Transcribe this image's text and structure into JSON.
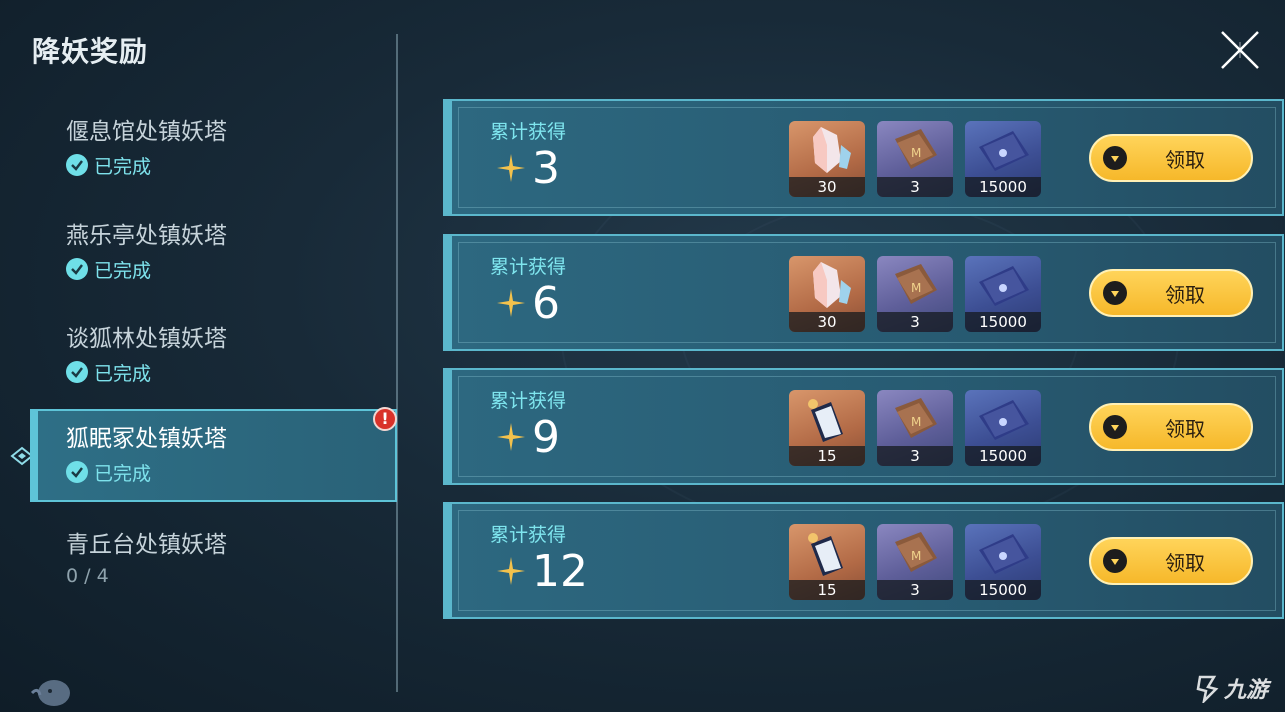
{
  "page": {
    "title": "降妖奖励"
  },
  "sidebar": {
    "items": [
      {
        "name": "偃息馆处镇妖塔",
        "status": "已完成"
      },
      {
        "name": "燕乐亭处镇妖塔",
        "status": "已完成"
      },
      {
        "name": "谈狐林处镇妖塔",
        "status": "已完成"
      },
      {
        "name": "狐眠冢处镇妖塔",
        "status": "已完成"
      },
      {
        "name": "青丘台处镇妖塔",
        "progress": "0 / 4"
      }
    ],
    "active_index": 3
  },
  "rewards": [
    {
      "label": "累计获得",
      "count": "3",
      "items": [
        {
          "icon": "crystal-icon",
          "qty": "30"
        },
        {
          "icon": "book-icon",
          "qty": "3"
        },
        {
          "icon": "ticket-icon",
          "qty": "15000"
        }
      ],
      "button": "领取"
    },
    {
      "label": "累计获得",
      "count": "6",
      "items": [
        {
          "icon": "crystal-icon",
          "qty": "30"
        },
        {
          "icon": "book-icon",
          "qty": "3"
        },
        {
          "icon": "ticket-icon",
          "qty": "15000"
        }
      ],
      "button": "领取"
    },
    {
      "label": "累计获得",
      "count": "9",
      "items": [
        {
          "icon": "scroll-icon",
          "qty": "15"
        },
        {
          "icon": "book-icon",
          "qty": "3"
        },
        {
          "icon": "ticket-icon",
          "qty": "15000"
        }
      ],
      "button": "领取"
    },
    {
      "label": "累计获得",
      "count": "12",
      "items": [
        {
          "icon": "scroll-icon",
          "qty": "15"
        },
        {
          "icon": "book-icon",
          "qty": "3"
        },
        {
          "icon": "ticket-icon",
          "qty": "15000"
        }
      ],
      "button": "领取"
    }
  ],
  "watermark": "九游",
  "colors": {
    "accent_cyan": "#5ec4d8",
    "card_bg": "#285d74",
    "button_gold": "#f6b82a",
    "alert_red": "#d9322a"
  }
}
